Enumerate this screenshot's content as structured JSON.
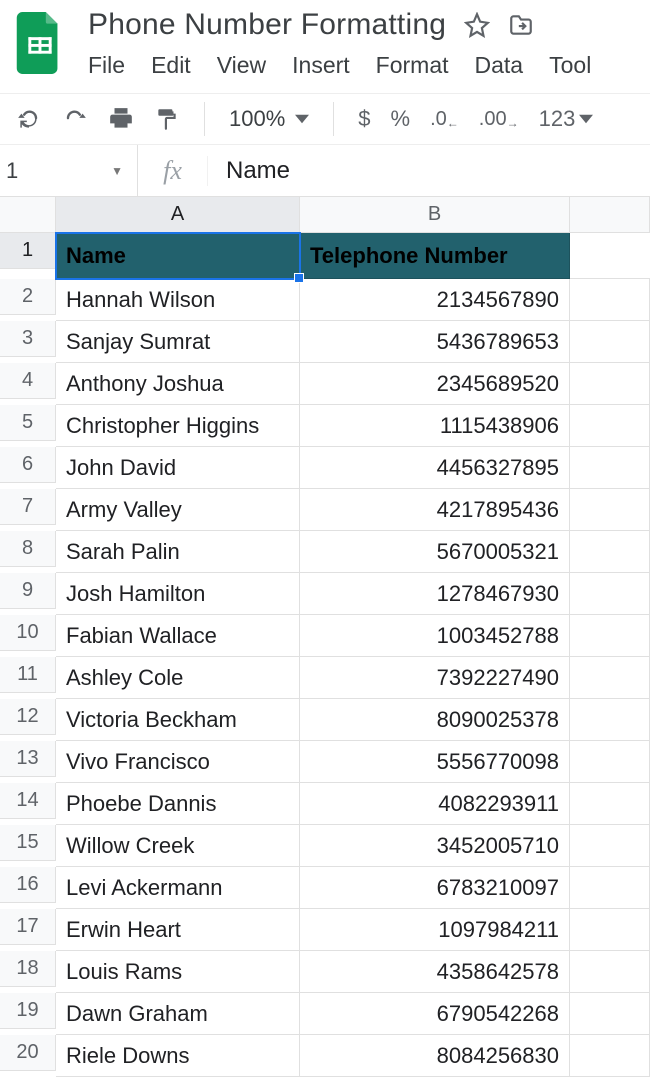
{
  "doc": {
    "title": "Phone Number Formatting"
  },
  "menus": {
    "file": "File",
    "edit": "Edit",
    "view": "View",
    "insert": "Insert",
    "format": "Format",
    "data": "Data",
    "tools": "Tool"
  },
  "toolbar": {
    "zoom": "100%",
    "currency": "$",
    "percent": "%",
    "dec_decrease": ".0",
    "dec_increase": ".00",
    "numfmt": "123"
  },
  "namebox": {
    "ref": "1"
  },
  "formula": {
    "value": "Name"
  },
  "columns": {
    "A": "A",
    "B": "B"
  },
  "headers": {
    "col_a": "Name",
    "col_b": "Telephone Number"
  },
  "sheet": {
    "rows": [
      {
        "n": "2",
        "name": "Hannah Wilson",
        "phone": "2134567890"
      },
      {
        "n": "3",
        "name": "Sanjay Sumrat",
        "phone": "5436789653"
      },
      {
        "n": "4",
        "name": "Anthony Joshua",
        "phone": "2345689520"
      },
      {
        "n": "5",
        "name": "Christopher Higgins",
        "phone": "1115438906"
      },
      {
        "n": "6",
        "name": "John David",
        "phone": "4456327895"
      },
      {
        "n": "7",
        "name": "Army Valley",
        "phone": "4217895436"
      },
      {
        "n": "8",
        "name": "Sarah Palin",
        "phone": "5670005321"
      },
      {
        "n": "9",
        "name": "Josh Hamilton",
        "phone": "1278467930"
      },
      {
        "n": "10",
        "name": "Fabian Wallace",
        "phone": "1003452788"
      },
      {
        "n": "11",
        "name": "Ashley Cole",
        "phone": "7392227490"
      },
      {
        "n": "12",
        "name": "Victoria Beckham",
        "phone": "8090025378"
      },
      {
        "n": "13",
        "name": "Vivo Francisco",
        "phone": "5556770098"
      },
      {
        "n": "14",
        "name": "Phoebe Dannis",
        "phone": "4082293911"
      },
      {
        "n": "15",
        "name": "Willow Creek",
        "phone": "3452005710"
      },
      {
        "n": "16",
        "name": "Levi Ackermann",
        "phone": "6783210097"
      },
      {
        "n": "17",
        "name": "Erwin Heart",
        "phone": "1097984211"
      },
      {
        "n": "18",
        "name": "Louis Rams",
        "phone": "4358642578"
      },
      {
        "n": "19",
        "name": "Dawn Graham",
        "phone": "6790542268"
      },
      {
        "n": "20",
        "name": "Riele Downs",
        "phone": "8084256830"
      }
    ]
  }
}
